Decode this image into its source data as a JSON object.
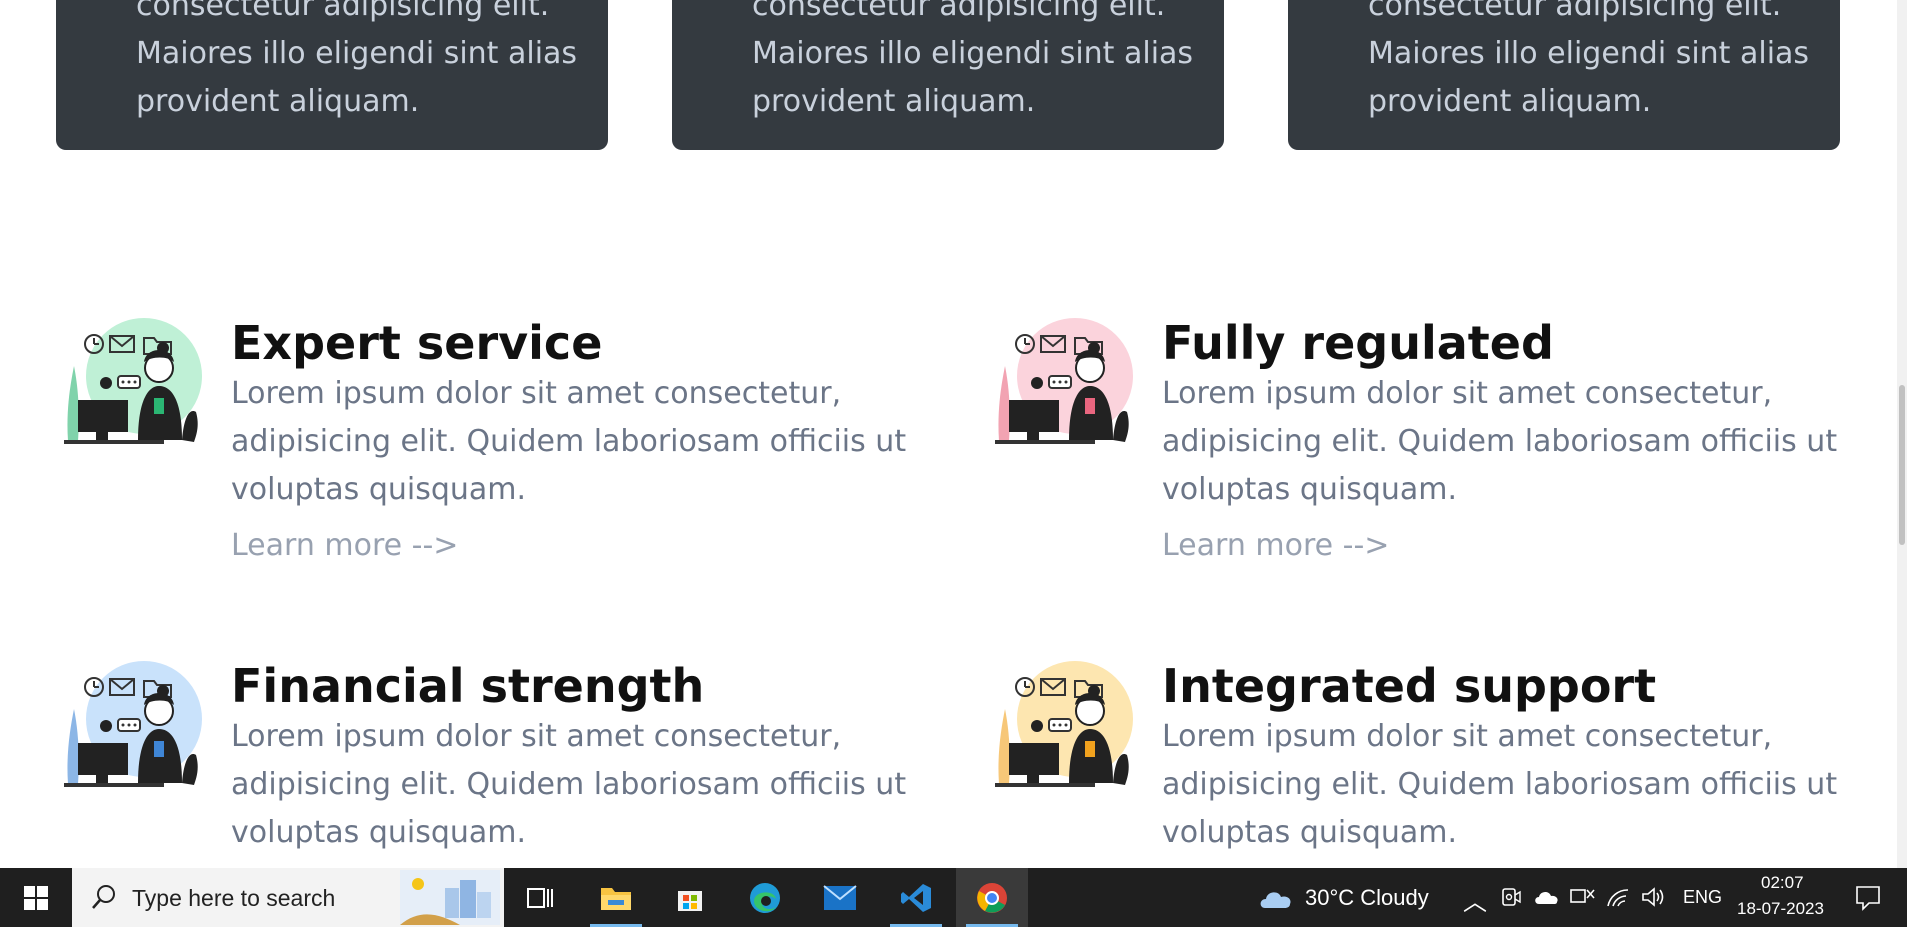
{
  "cards": [
    {
      "lines": [
        "consectetur adipisicing elit.",
        "Maiores illo eligendi sint alias",
        "provident aliquam."
      ]
    },
    {
      "lines": [
        "consectetur adipisicing elit.",
        "Maiores illo eligendi sint alias",
        "provident aliquam."
      ]
    },
    {
      "lines": [
        "consectetur adipisicing elit.",
        "Maiores illo eligendi sint alias",
        "provident aliquam."
      ]
    }
  ],
  "features": [
    {
      "title": "Expert service",
      "desc": [
        "Lorem ipsum dolor sit amet consectetur,",
        "adipisicing elit. Quidem laboriosam officiis ut",
        "voluptas quisquam."
      ],
      "link": "Learn more -->",
      "accent": "#bff0d6",
      "badge": "#2bb673"
    },
    {
      "title": "Fully regulated",
      "desc": [
        "Lorem ipsum dolor sit amet consectetur,",
        "adipisicing elit. Quidem laboriosam officiis ut",
        "voluptas quisquam."
      ],
      "link": "Learn more -->",
      "accent": "#fbd3dc",
      "badge": "#e9667f"
    },
    {
      "title": "Financial strength",
      "desc": [
        "Lorem ipsum dolor sit amet consectetur,",
        "adipisicing elit. Quidem laboriosam officiis ut",
        "voluptas quisquam."
      ],
      "link": "",
      "accent": "#c9e2fb",
      "badge": "#3f86d6"
    },
    {
      "title": "Integrated support",
      "desc": [
        "Lorem ipsum dolor sit amet consectetur,",
        "adipisicing elit. Quidem laboriosam officiis ut",
        "voluptas quisquam."
      ],
      "link": "",
      "accent": "#fde6b0",
      "badge": "#f1a21e"
    }
  ],
  "taskbar": {
    "search_placeholder": "Type here to search",
    "weather": "30°C  Cloudy",
    "language": "ENG",
    "time": "02:07",
    "date": "18-07-2023",
    "apps": [
      "task-view-icon",
      "file-explorer-icon",
      "microsoft-store-icon",
      "edge-icon",
      "mail-icon",
      "vscode-icon",
      "chrome-icon"
    ]
  }
}
